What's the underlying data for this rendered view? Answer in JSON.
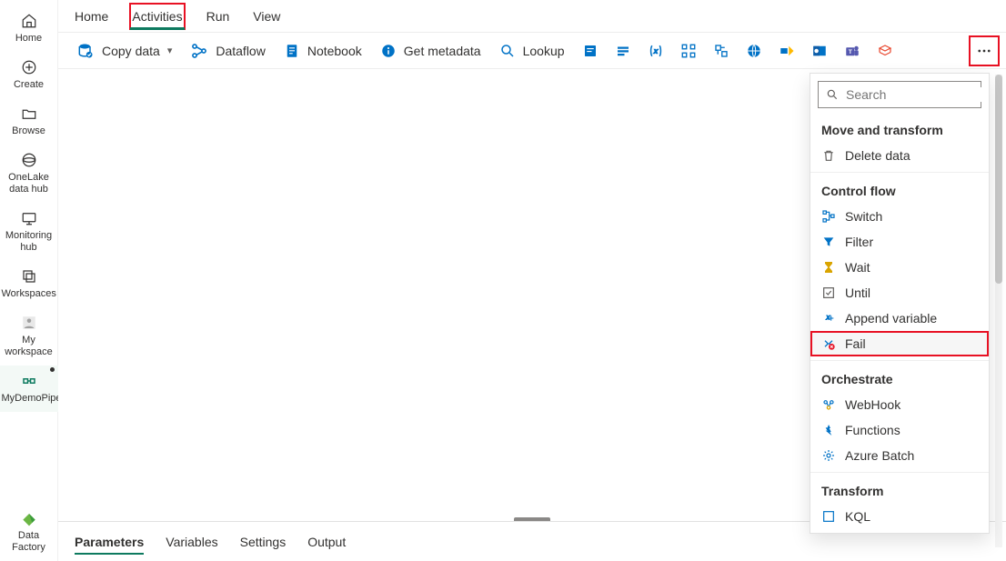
{
  "leftnav": {
    "items": [
      {
        "label": "Home"
      },
      {
        "label": "Create"
      },
      {
        "label": "Browse"
      },
      {
        "label": "OneLake data hub"
      },
      {
        "label": "Monitoring hub"
      },
      {
        "label": "Workspaces"
      },
      {
        "label": "My workspace"
      },
      {
        "label": "MyDemoPipeline"
      }
    ],
    "footer": {
      "label": "Data Factory"
    }
  },
  "tabs": {
    "items": [
      {
        "label": "Home"
      },
      {
        "label": "Activities"
      },
      {
        "label": "Run"
      },
      {
        "label": "View"
      }
    ]
  },
  "toolbar": {
    "copy": "Copy data",
    "dataflow": "Dataflow",
    "notebook": "Notebook",
    "getmeta": "Get metadata",
    "lookup": "Lookup"
  },
  "dropdown": {
    "search_placeholder": "Search",
    "sections": {
      "move": "Move and transform",
      "control": "Control flow",
      "orchestrate": "Orchestrate",
      "transform": "Transform"
    },
    "items": {
      "delete": "Delete data",
      "switch": "Switch",
      "filter": "Filter",
      "wait": "Wait",
      "until": "Until",
      "append": "Append variable",
      "fail": "Fail",
      "webhook": "WebHook",
      "functions": "Functions",
      "azurebatch": "Azure Batch",
      "kql": "KQL"
    }
  },
  "bottomTabs": {
    "items": [
      {
        "label": "Parameters"
      },
      {
        "label": "Variables"
      },
      {
        "label": "Settings"
      },
      {
        "label": "Output"
      }
    ]
  }
}
